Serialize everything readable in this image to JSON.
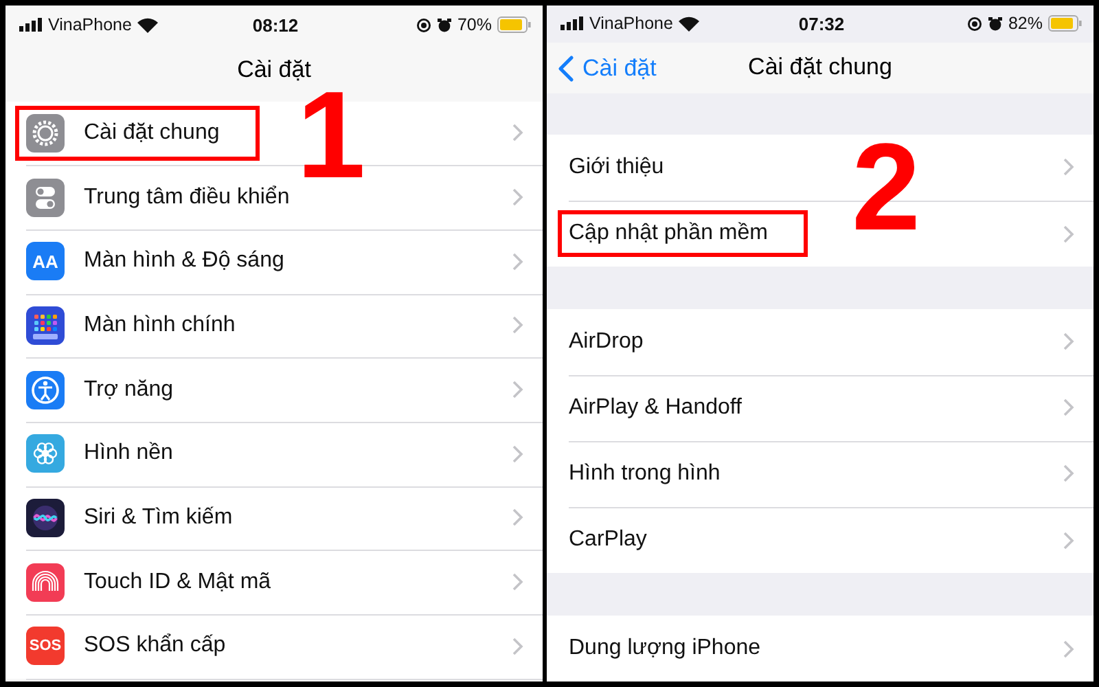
{
  "screens": [
    {
      "kind": "icons",
      "status_bar": {
        "carrier": "VinaPhone",
        "time": "08:12",
        "battery": "70%"
      },
      "nav": {
        "title": "Cài đặt"
      },
      "callout": "1",
      "groups": [
        {
          "rows": [
            {
              "label": "Cài đặt chung",
              "highlighted": true
            },
            {
              "label": "Trung tâm điều khiển",
              "highlighted": false
            },
            {
              "label": "Màn hình & Độ sáng",
              "highlighted": false,
              "icon_text": "AA"
            },
            {
              "label": "Màn hình chính",
              "highlighted": false
            },
            {
              "label": "Trợ năng",
              "highlighted": false
            },
            {
              "label": "Hình nền",
              "highlighted": false
            },
            {
              "label": "Siri & Tìm kiếm",
              "highlighted": false
            },
            {
              "label": "Touch ID & Mật mã",
              "highlighted": false
            },
            {
              "label": "SOS khẩn cấp",
              "highlighted": false,
              "icon_text": "SOS"
            }
          ]
        }
      ]
    },
    {
      "kind": "plain",
      "status_bar": {
        "carrier": "VinaPhone",
        "time": "07:32",
        "battery": "82%"
      },
      "nav": {
        "back": "Cài đặt",
        "title": "Cài đặt chung"
      },
      "callout": "2",
      "groups": [
        {
          "rows": [
            {
              "label": "Giới thiệu",
              "highlighted": false
            },
            {
              "label": "Cập nhật phần mềm",
              "highlighted": true
            }
          ]
        },
        {
          "rows": [
            {
              "label": "AirDrop",
              "highlighted": false
            },
            {
              "label": "AirPlay & Handoff",
              "highlighted": false
            },
            {
              "label": "Hình trong hình",
              "highlighted": false
            },
            {
              "label": "CarPlay",
              "highlighted": false
            }
          ]
        },
        {
          "rows": [
            {
              "label": "Dung lượng iPhone",
              "highlighted": false
            }
          ]
        }
      ]
    }
  ]
}
